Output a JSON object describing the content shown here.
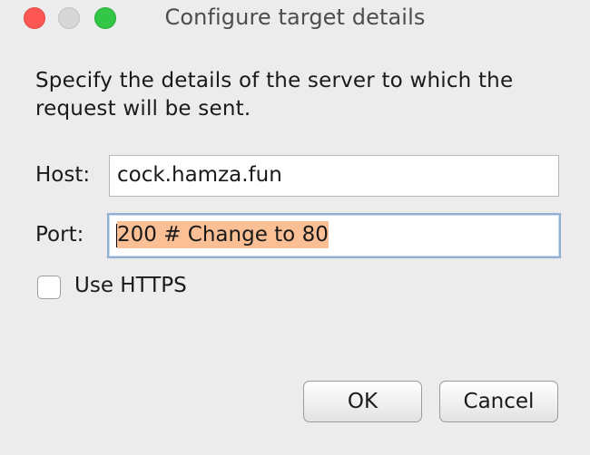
{
  "window": {
    "title": "Configure target details",
    "controls": {
      "close_icon": "close-icon",
      "minimize_icon": "minimize-icon",
      "zoom_icon": "zoom-icon"
    }
  },
  "dialog": {
    "instruction": "Specify the details of the server to which the request will be sent.",
    "host": {
      "label": "Host:",
      "value": "cock.hamza.fun"
    },
    "port": {
      "label": "Port:",
      "value": "200 # Change to 80",
      "selected": true
    },
    "https": {
      "label": "Use HTTPS",
      "checked": false
    },
    "buttons": {
      "ok_label": "OK",
      "cancel_label": "Cancel"
    }
  },
  "colors": {
    "close": "#fc5753",
    "minimize": "#d7d7d7",
    "zoom": "#33c748",
    "selection": "#fbbf95",
    "focus_ring": "#8fb0d1"
  }
}
